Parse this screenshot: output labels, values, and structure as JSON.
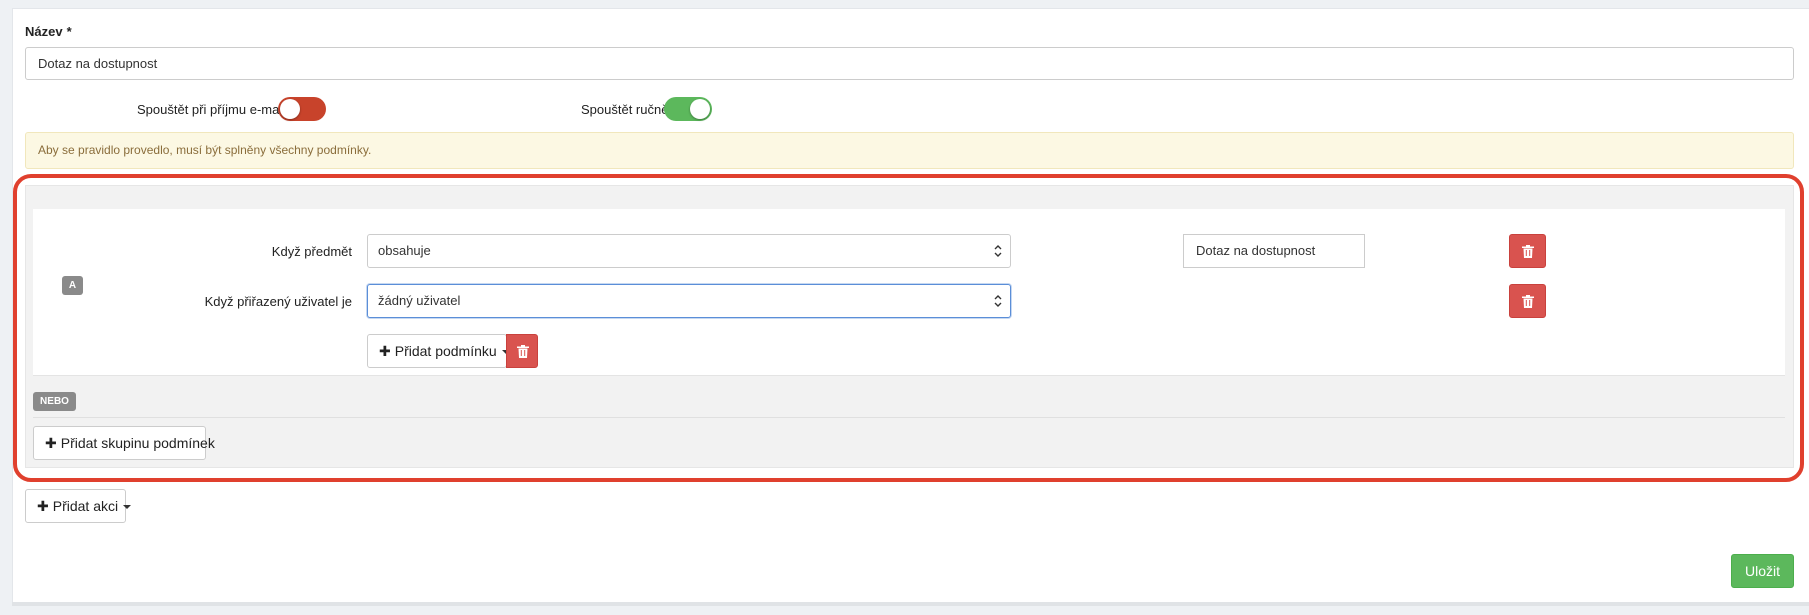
{
  "form": {
    "name_label": "Název",
    "required_mark": "*",
    "name_value": "Dotaz na dostupnost",
    "toggle_email_label": "Spouštět při příjmu e-mailu",
    "toggle_email_on": false,
    "toggle_manual_label": "Spouštět ručně",
    "toggle_manual_on": true,
    "alert_text": "Aby se pravidlo provedlo, musí být splněny všechny podmínky."
  },
  "conditions": {
    "group_badge": "A",
    "rows": [
      {
        "label": "Když předmět",
        "operator": "obsahuje",
        "value": "Dotaz na dostupnost"
      },
      {
        "label": "Když přiřazený uživatel je",
        "operator": "žádný uživatel"
      }
    ],
    "add_condition_label": "Přidat podmínku",
    "or_badge": "NEBO",
    "add_group_label": "Přidat skupinu podmínek"
  },
  "actions": {
    "add_action_label": "Přidat akci"
  },
  "save_label": "Uložit",
  "icons": {
    "delete": "trash-icon",
    "add": "plus-icon",
    "select": "updown-caret-icon",
    "dropdown": "caret-down-icon"
  },
  "colors": {
    "danger": "#d9534f",
    "success": "#5cb85c",
    "toggle_off": "#c8432b",
    "highlight": "#e0402e",
    "alert_bg": "#fcf8e3"
  }
}
